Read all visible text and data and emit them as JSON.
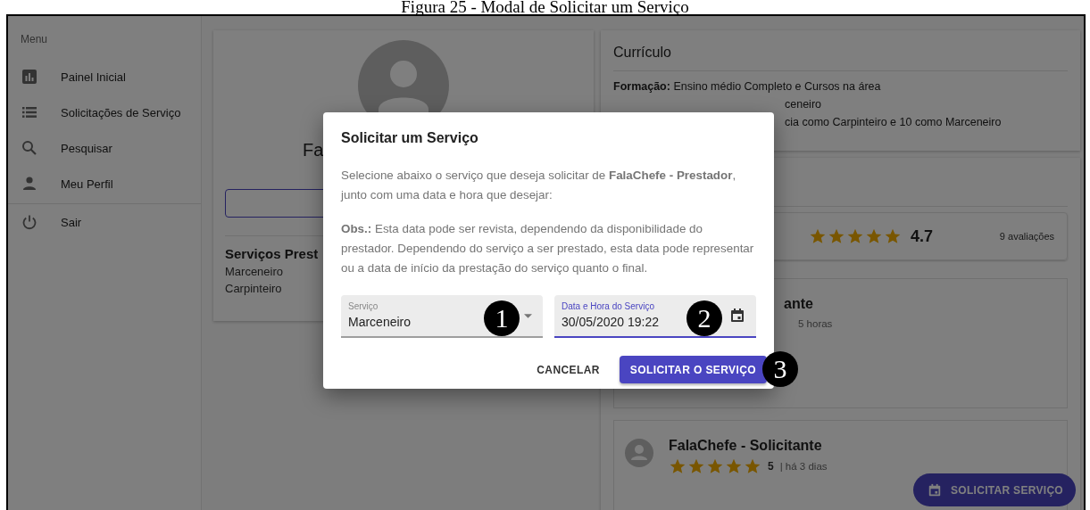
{
  "caption": "Figura 25 - Modal de Solicitar um Serviço",
  "sidebar": {
    "heading": "Menu",
    "items": [
      {
        "label": "Painel Inicial"
      },
      {
        "label": "Solicitações de Serviço"
      },
      {
        "label": "Pesquisar"
      },
      {
        "label": "Meu Perfil"
      }
    ],
    "footer_items": [
      {
        "label": "Sair"
      }
    ]
  },
  "profile_card": {
    "name": "Fa",
    "services_heading": "Serviços Prest",
    "services": [
      "Marceneiro",
      "Carpinteiro"
    ]
  },
  "curriculum": {
    "title": "Currículo",
    "lines": [
      "**Formação:** Ensino médio Completo e Cursos na área",
      "ceneiro",
      "cia como Carpinteiro e 10 como Marceneiro"
    ]
  },
  "rating": {
    "stars": 5,
    "score": "4.7",
    "count": "9 avaliações"
  },
  "reviews": [
    {
      "kind": "cut",
      "title": "ante",
      "meta": "5 horas"
    },
    {
      "kind": "full",
      "title": "FalaChefe - Solicitante",
      "stars": 5,
      "score": "5",
      "meta": "| há 3 dias"
    }
  ],
  "fab": {
    "label": "SOLICITAR SERVIÇO"
  },
  "dialog": {
    "title": "Solicitar um Serviço",
    "paragraphs": [
      "Selecione abaixo o serviço que deseja solicitar de **FalaChefe - Prestador**, junto com uma data e hora que desejar:",
      "**Obs.:** Esta data pode ser revista, dependendo da disponibilidade do prestador. Dependendo do serviço a ser prestado, esta data pode representar ou a data de início da prestação do serviço quanto o final."
    ],
    "fields": [
      {
        "kind": "select",
        "label": "Serviço",
        "value": "Marceneiro",
        "focused": false
      },
      {
        "kind": "date",
        "label": "Data e Hora do Serviço",
        "value": "30/05/2020 19:22",
        "focused": true
      }
    ],
    "buttons": [
      {
        "kind": "text",
        "label": "CANCELAR"
      },
      {
        "kind": "primary",
        "label": "SOLICITAR O SERVIÇO"
      }
    ]
  },
  "callouts": [
    "1",
    "2",
    "3"
  ]
}
